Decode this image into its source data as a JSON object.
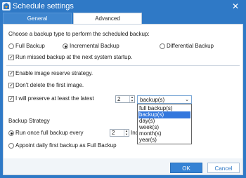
{
  "window": {
    "title": "Schedule settings",
    "close_label": "✕"
  },
  "tabs": [
    {
      "label": "General"
    },
    {
      "label": "Advanced"
    }
  ],
  "backup_type": {
    "prompt": "Choose a backup type to perform the scheduled backup:",
    "options": [
      {
        "label": "Full Backup",
        "selected": false
      },
      {
        "label": "Incremental Backup",
        "selected": true
      },
      {
        "label": "Differential Backup",
        "selected": false
      }
    ]
  },
  "checks": {
    "run_missed": {
      "label": "Run missed backup at the next system startup.",
      "checked": true
    },
    "image_reserve": {
      "label": "Enable image reserve strategy.",
      "checked": true
    },
    "dont_delete_first": {
      "label": "Don't delete the first image.",
      "checked": true
    },
    "preserve_latest": {
      "label": "I will preserve at least the latest",
      "checked": true
    }
  },
  "preserve": {
    "count": "2",
    "unit_value": "backup(s)",
    "unit_options": [
      "full backup(s)",
      "backup(s)",
      "day(s)",
      "week(s)",
      "month(s)",
      "year(s)"
    ],
    "highlighted_option": "backup(s)"
  },
  "strategy": {
    "heading": "Backup Strategy",
    "run_once_label": "Run once full backup every",
    "run_once_count": "2",
    "run_once_suffix": "Incrementa",
    "appoint_label": "Appoint daily first backup as Full Backup",
    "run_once_selected": true,
    "appoint_selected": false
  },
  "buttons": {
    "ok": "OK",
    "cancel": "Cancel"
  },
  "colors": {
    "title_bar": "#2f79c6",
    "highlight": "#3377dd",
    "ok_button": "#3582d4"
  },
  "icons": {
    "app": "schedule-app-icon",
    "close": "close-icon",
    "dropdown": "chevron-down-icon",
    "spin": "spin-arrows-icon"
  }
}
